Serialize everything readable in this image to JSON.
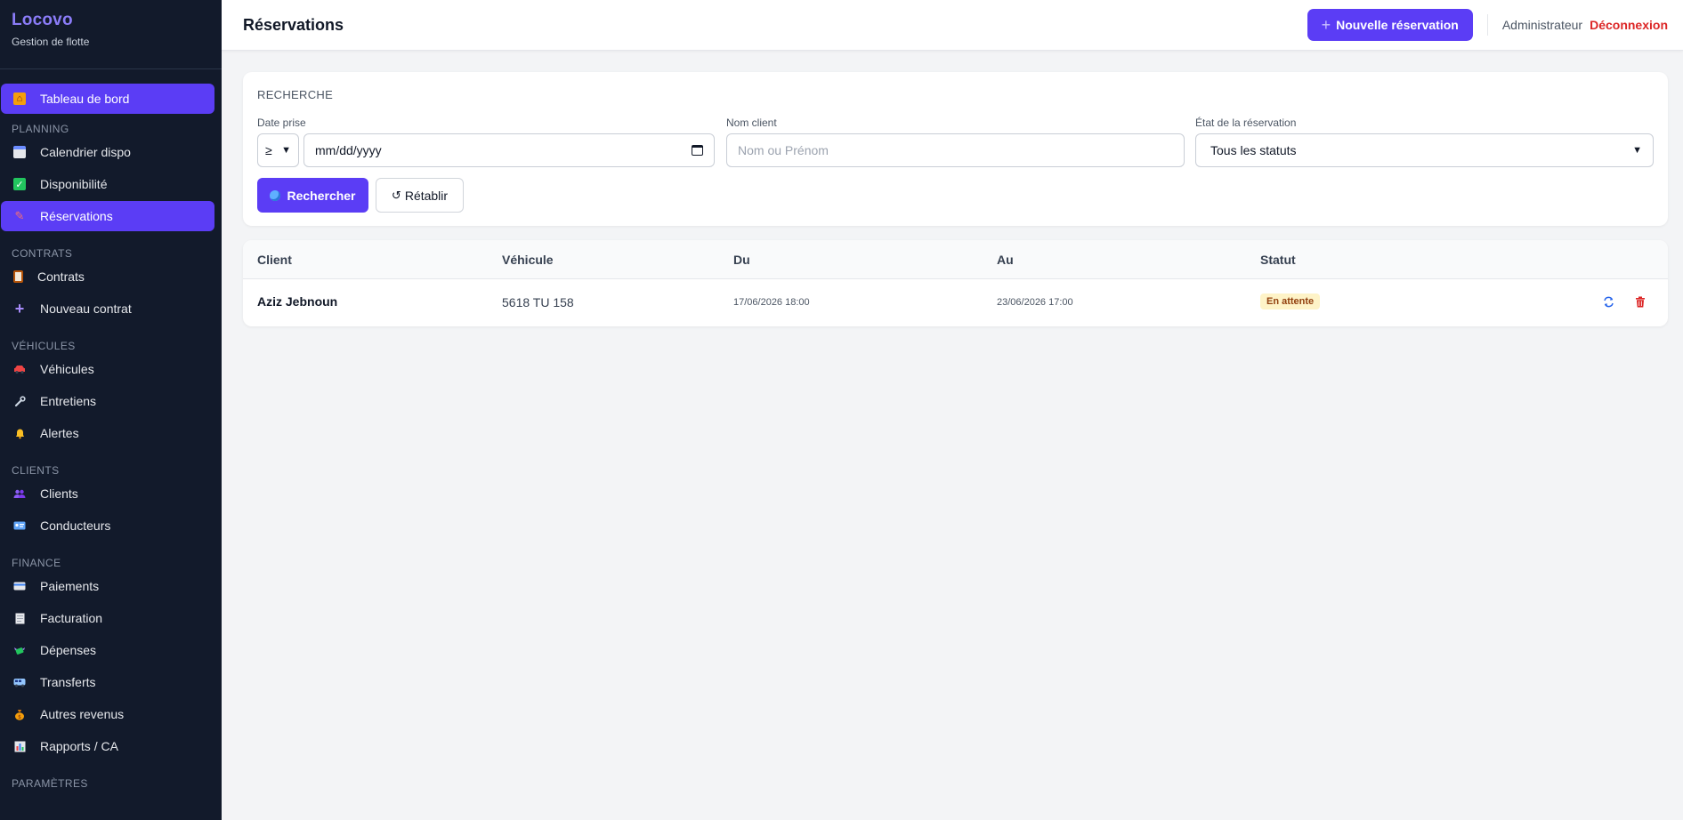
{
  "brand": {
    "title": "Locovo",
    "subtitle": "Gestion de flotte"
  },
  "sidebar": {
    "top_item": {
      "label": "Tableau de bord",
      "icon": "home-icon"
    },
    "sections": [
      {
        "label": "PLANNING",
        "items": [
          {
            "label": "Calendrier dispo",
            "icon": "calendar-icon"
          },
          {
            "label": "Disponibilité",
            "icon": "check-box-icon"
          },
          {
            "label": "Réservations",
            "icon": "pushpin-icon",
            "active": true
          }
        ]
      },
      {
        "label": "CONTRATS",
        "items": [
          {
            "label": "Contrats",
            "icon": "clipboard-icon"
          },
          {
            "label": "Nouveau contrat",
            "icon": "plus-icon"
          }
        ]
      },
      {
        "label": "VÉHICULES",
        "items": [
          {
            "label": "Véhicules",
            "icon": "car-icon"
          },
          {
            "label": "Entretiens",
            "icon": "wrench-icon"
          },
          {
            "label": "Alertes",
            "icon": "bell-icon"
          }
        ]
      },
      {
        "label": "CLIENTS",
        "items": [
          {
            "label": "Clients",
            "icon": "users-icon"
          },
          {
            "label": "Conducteurs",
            "icon": "id-card-icon"
          }
        ]
      },
      {
        "label": "FINANCE",
        "items": [
          {
            "label": "Paiements",
            "icon": "credit-card-icon"
          },
          {
            "label": "Facturation",
            "icon": "receipt-icon"
          },
          {
            "label": "Dépenses",
            "icon": "money-wings-icon"
          },
          {
            "label": "Transferts",
            "icon": "bus-icon"
          },
          {
            "label": "Autres revenus",
            "icon": "money-bag-icon"
          },
          {
            "label": "Rapports / CA",
            "icon": "bar-chart-icon"
          }
        ]
      },
      {
        "label": "PARAMÈTRES",
        "items": []
      }
    ]
  },
  "header": {
    "title": "Réservations",
    "new_button": "Nouvelle réservation",
    "user": "Administrateur",
    "logout": "Déconnexion"
  },
  "search": {
    "title": "RECHERCHE",
    "date_label": "Date prise",
    "operator": "≥",
    "date_placeholder": "mm/dd/yyyy",
    "client_label": "Nom client",
    "client_placeholder": "Nom ou Prénom",
    "status_label": "État de la réservation",
    "status_value": "Tous les statuts",
    "search_button": "Rechercher",
    "reset_button": "Rétablir"
  },
  "table": {
    "columns": [
      "Client",
      "Véhicule",
      "Du",
      "Au",
      "Statut"
    ],
    "rows": [
      {
        "client": "Aziz Jebnoun",
        "vehicle": "5618 TU 158",
        "from": "17/06/2026 18:00",
        "to": "23/06/2026 17:00",
        "status": "En attente"
      }
    ]
  },
  "colors": {
    "accent": "#5b3df5",
    "sidebar_bg": "#121a2b",
    "danger": "#dc2626",
    "pending_bg": "#fef3c7"
  }
}
